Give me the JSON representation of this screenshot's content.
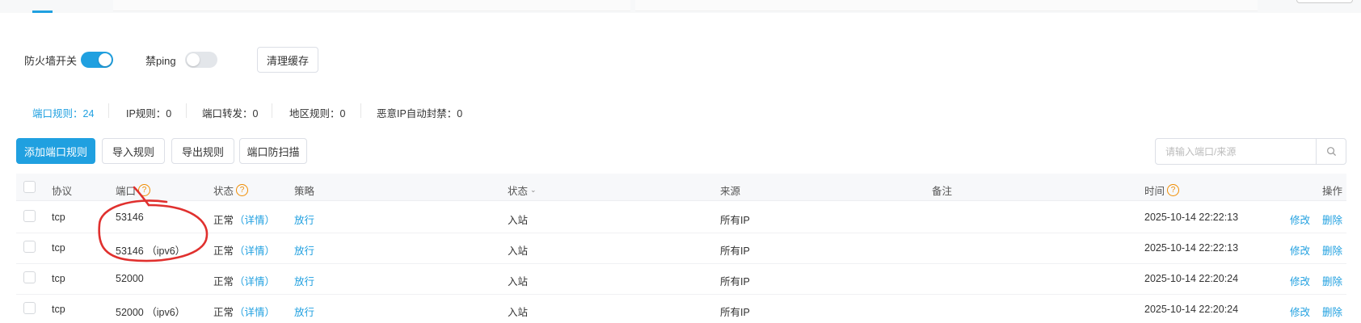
{
  "controls": {
    "firewall_label": "防火墙开关",
    "ban_ping_label": "禁ping",
    "clear_cache_label": "清理缓存"
  },
  "stats": [
    {
      "label": "端口规则：24"
    },
    {
      "label": "IP规则：0"
    },
    {
      "label": "端口转发：0"
    },
    {
      "label": "地区规则：0"
    },
    {
      "label": "恶意IP自动封禁：0"
    }
  ],
  "toolbar": {
    "add_label": "添加端口规则",
    "import_label": "导入规则",
    "export_label": "导出规则",
    "scan_label": "端口防扫描",
    "search_placeholder": "请输入端口/来源"
  },
  "columns": {
    "protocol": "协议",
    "port": "端口",
    "status": "状态",
    "policy": "策略",
    "direction": "状态",
    "source": "来源",
    "remark": "备注",
    "time": "时间",
    "actions": "操作"
  },
  "rows": [
    {
      "protocol": "tcp",
      "port": "53146",
      "status": "正常",
      "details": "（详情）",
      "policy": "放行",
      "direction": "入站",
      "source": "所有IP",
      "time": "2025-10-14 22:22:13",
      "edit": "修改",
      "delete": "删除"
    },
    {
      "protocol": "tcp",
      "port": "53146 （ipv6）",
      "status": "正常",
      "details": "（详情）",
      "policy": "放行",
      "direction": "入站",
      "source": "所有IP",
      "time": "2025-10-14 22:22:13",
      "edit": "修改",
      "delete": "删除"
    },
    {
      "protocol": "tcp",
      "port": "52000",
      "status": "正常",
      "details": "（详情）",
      "policy": "放行",
      "direction": "入站",
      "source": "所有IP",
      "time": "2025-10-14 22:20:24",
      "edit": "修改",
      "delete": "删除"
    },
    {
      "protocol": "tcp",
      "port": "52000 （ipv6）",
      "status": "正常",
      "details": "（详情）",
      "policy": "放行",
      "direction": "入站",
      "source": "所有IP",
      "time": "2025-10-14 22:20:24",
      "edit": "修改",
      "delete": "删除"
    }
  ],
  "colors": {
    "accent": "#20a0e0",
    "annotation": "#e0302e",
    "help": "#f08c00"
  }
}
